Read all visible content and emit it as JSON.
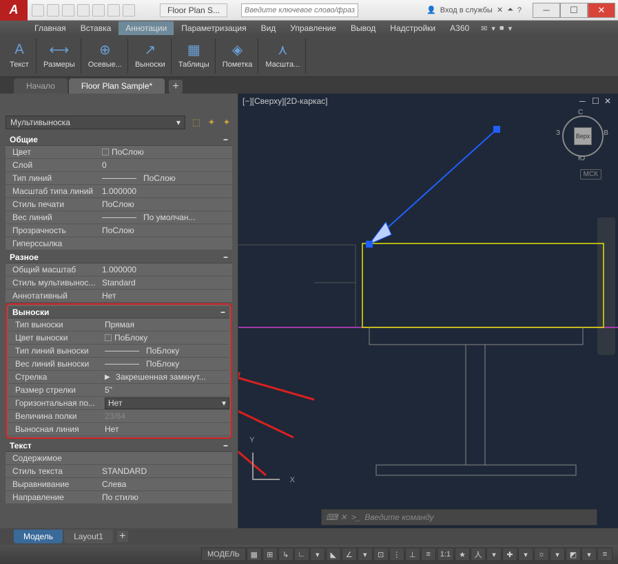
{
  "app_logo": "A",
  "title_tab": "Floor Plan S...",
  "search_placeholder": "Введите ключевое слово/фразу",
  "login_text": "Вход в службы",
  "menu": [
    "Главная",
    "Вставка",
    "Аннотации",
    "Параметризация",
    "Вид",
    "Управление",
    "Вывод",
    "Надстройки",
    "A360"
  ],
  "menu_active_index": 2,
  "ribbon": [
    {
      "label": "Текст",
      "icon": "A"
    },
    {
      "label": "Размеры",
      "icon": "⟷"
    },
    {
      "label": "Осевые...",
      "icon": "⊕"
    },
    {
      "label": "Выноски",
      "icon": "↗"
    },
    {
      "label": "Таблицы",
      "icon": "▦"
    },
    {
      "label": "Пометка",
      "icon": "◈"
    },
    {
      "label": "Масшта...",
      "icon": "⋏"
    }
  ],
  "doc_tabs": {
    "items": [
      "Начало",
      "Floor Plan Sample*"
    ],
    "active": 1
  },
  "properties": {
    "selector": "Мультивыноска",
    "sections": [
      {
        "title": "Общие",
        "rows": [
          {
            "label": "Цвет",
            "value": "ПоСлою",
            "swatch": true
          },
          {
            "label": "Слой",
            "value": "0"
          },
          {
            "label": "Тип линий",
            "value": "ПоСлою",
            "line": true
          },
          {
            "label": "Масштаб типа линий",
            "value": "1.000000"
          },
          {
            "label": "Стиль печати",
            "value": "ПоСлою"
          },
          {
            "label": "Вес линий",
            "value": "По умолчан...",
            "line": true
          },
          {
            "label": "Прозрачность",
            "value": "ПоСлою"
          },
          {
            "label": "Гиперссылка",
            "value": ""
          }
        ]
      },
      {
        "title": "Разное",
        "rows": [
          {
            "label": "Общий масштаб",
            "value": "1.000000"
          },
          {
            "label": "Стиль мультивынос...",
            "value": "Standard"
          },
          {
            "label": "Аннотативный",
            "value": "Нет"
          }
        ]
      },
      {
        "title": "Выноски",
        "highlighted": true,
        "rows": [
          {
            "label": "Тип выноски",
            "value": "Прямая"
          },
          {
            "label": "Цвет выноски",
            "value": "ПоБлоку",
            "swatch": true
          },
          {
            "label": "Тип линий выноски",
            "value": "ПоБлоку",
            "line": true
          },
          {
            "label": "Вес линий выноски",
            "value": "ПоБлоку",
            "line": true
          },
          {
            "label": "Стрелка",
            "value": "Закрешенная замкнут...",
            "arrow": true
          },
          {
            "label": "Размер стрелки",
            "value": "5\""
          },
          {
            "label": "Горизонтальная по...",
            "value": "Нет",
            "dropdown": true
          },
          {
            "label": "Величина полки",
            "value": "23/64",
            "dim": true
          },
          {
            "label": "Выносная линия",
            "value": "Нет"
          }
        ]
      },
      {
        "title": "Текст",
        "rows": [
          {
            "label": "Содержимое",
            "value": ""
          },
          {
            "label": "Стиль текста",
            "value": "STANDARD"
          },
          {
            "label": "Выравнивание",
            "value": "Слева"
          },
          {
            "label": "Направление",
            "value": "По стилю"
          }
        ]
      }
    ]
  },
  "viewport": {
    "label": "[−][Сверху][2D-каркас]",
    "cube": {
      "top": "Верх",
      "n": "С",
      "s": "Ю",
      "e": "В",
      "w": "З"
    },
    "msk": "МСК",
    "axis": {
      "x": "X",
      "y": "Y"
    }
  },
  "cmdline": {
    "prompt": ">_",
    "placeholder": "Введите команду"
  },
  "bottom_tabs": {
    "items": [
      "Модель",
      "Layout1"
    ],
    "active": 0
  },
  "status": {
    "model": "МОДЕЛЬ",
    "scale": "1:1",
    "icons": [
      "▦",
      "⊞",
      "↳",
      "∟",
      "▾",
      "◣",
      "∠",
      "▾",
      "⊡",
      "⋮",
      "⊥",
      "≡",
      "★",
      "人",
      "▾",
      "✚",
      "▾",
      "☼",
      "▾",
      "◩",
      "▾",
      "≡"
    ]
  }
}
